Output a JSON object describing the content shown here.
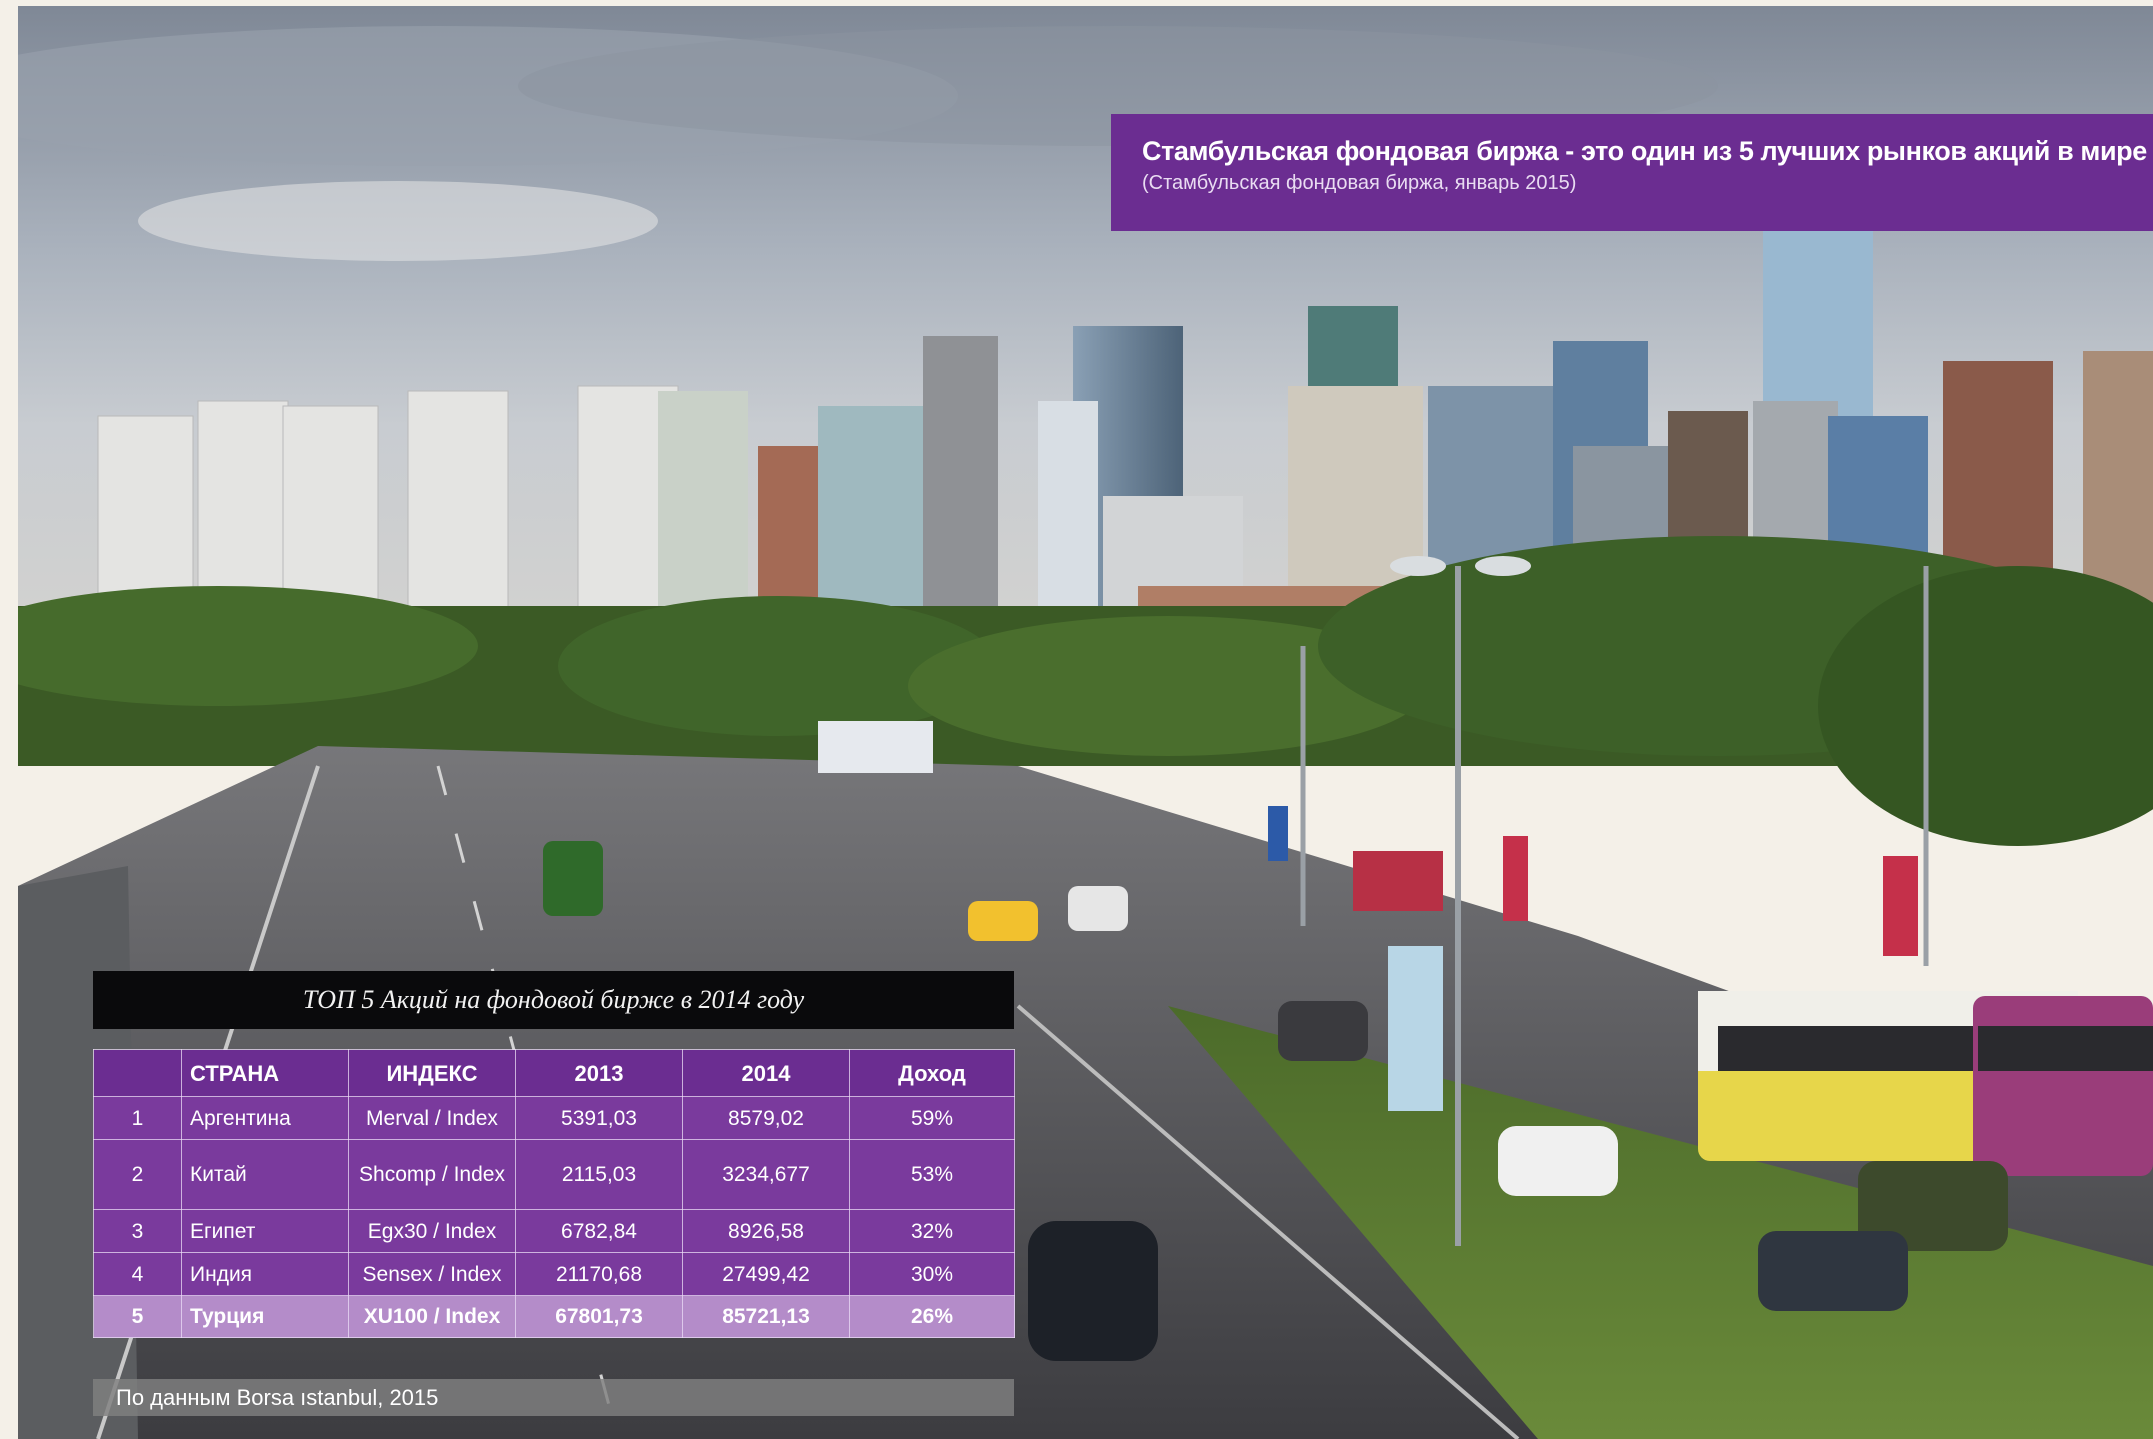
{
  "banner": {
    "title": "Стамбульская фондовая биржа - это один из 5 лучших рынков акций в мире",
    "subtitle": "(Стамбульская фондовая биржа, январь 2015)"
  },
  "table": {
    "title": "ТОП 5 Акций на фондовой бирже в 2014 году",
    "headers": [
      "",
      "СТРАНА",
      "ИНДЕКС",
      "2013",
      "2014",
      "Доход"
    ],
    "rows": [
      [
        "1",
        "Аргентина",
        "Merval / Index",
        "5391,03",
        "8579,02",
        "59%"
      ],
      [
        "2",
        "Китай",
        "Shcomp / Index",
        "2115,03",
        "3234,677",
        "53%"
      ],
      [
        "3",
        "Египет",
        "Egx30 / Index",
        "6782,84",
        "8926,58",
        "32%"
      ],
      [
        "4",
        "Индия",
        "Sensex / Index",
        "21170,68",
        "27499,42",
        "30%"
      ],
      [
        "5",
        "Турция",
        "XU100 / Index",
        "67801,73",
        "85721,13",
        "26%"
      ]
    ],
    "highlight_row": 5
  },
  "source": "По данным Borsa ıstanbul, 2015",
  "colors": {
    "accent_purple": "#6b2d91",
    "row_purple": "#7a3a9d",
    "highlight_lavender": "#b48cc9",
    "title_bar": "#0a0a0c"
  }
}
